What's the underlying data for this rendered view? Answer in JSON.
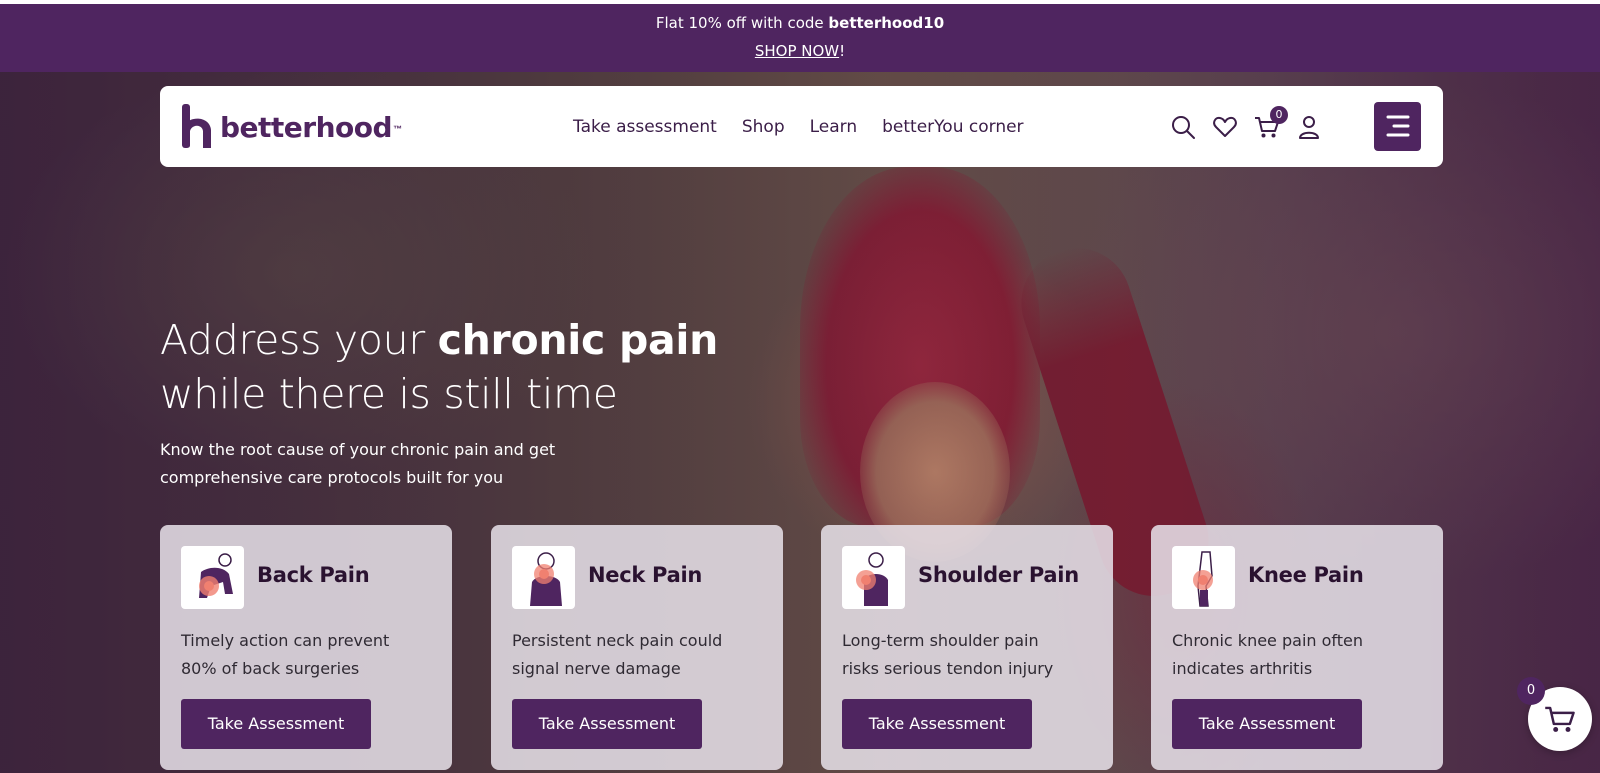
{
  "promo": {
    "text_prefix": "Flat 10% off with code ",
    "code": "betterhood10",
    "link_label": "SHOP NOW",
    "link_suffix": "!"
  },
  "brand": {
    "name": "betterhood",
    "trademark": "™",
    "color": "#4f2560"
  },
  "nav": {
    "links": [
      "Take assessment",
      "Shop",
      "Learn",
      "betterYou corner"
    ],
    "icons": [
      "search-icon",
      "heart-icon",
      "cart-icon",
      "user-icon"
    ],
    "cart_count": "0"
  },
  "hero": {
    "headline_light_1": "Address your ",
    "headline_bold": "chronic pain",
    "headline_light_2": "while there is still time",
    "subtext_line1": "Know the root cause of your chronic pain and get",
    "subtext_line2": "comprehensive care protocols built for you"
  },
  "cards": [
    {
      "title": "Back Pain",
      "desc_line1": "Timely action can prevent",
      "desc_line2": "80% of back surgeries",
      "button": "Take Assessment",
      "icon": "back-pain-icon"
    },
    {
      "title": "Neck Pain",
      "desc_line1": "Persistent neck pain could",
      "desc_line2": "signal nerve damage",
      "button": "Take Assessment",
      "icon": "neck-pain-icon"
    },
    {
      "title": "Shoulder Pain",
      "desc_line1": "Long-term shoulder pain",
      "desc_line2": "risks serious tendon injury",
      "button": "Take Assessment",
      "icon": "shoulder-pain-icon"
    },
    {
      "title": "Knee Pain",
      "desc_line1": "Chronic knee pain often",
      "desc_line2": "indicates arthritis",
      "button": "Take Assessment",
      "icon": "knee-pain-icon"
    }
  ],
  "floating_cart": {
    "count": "0",
    "icon": "cart-icon"
  },
  "colors": {
    "accent": "#4f2560",
    "pain_highlight": "#f08070"
  }
}
